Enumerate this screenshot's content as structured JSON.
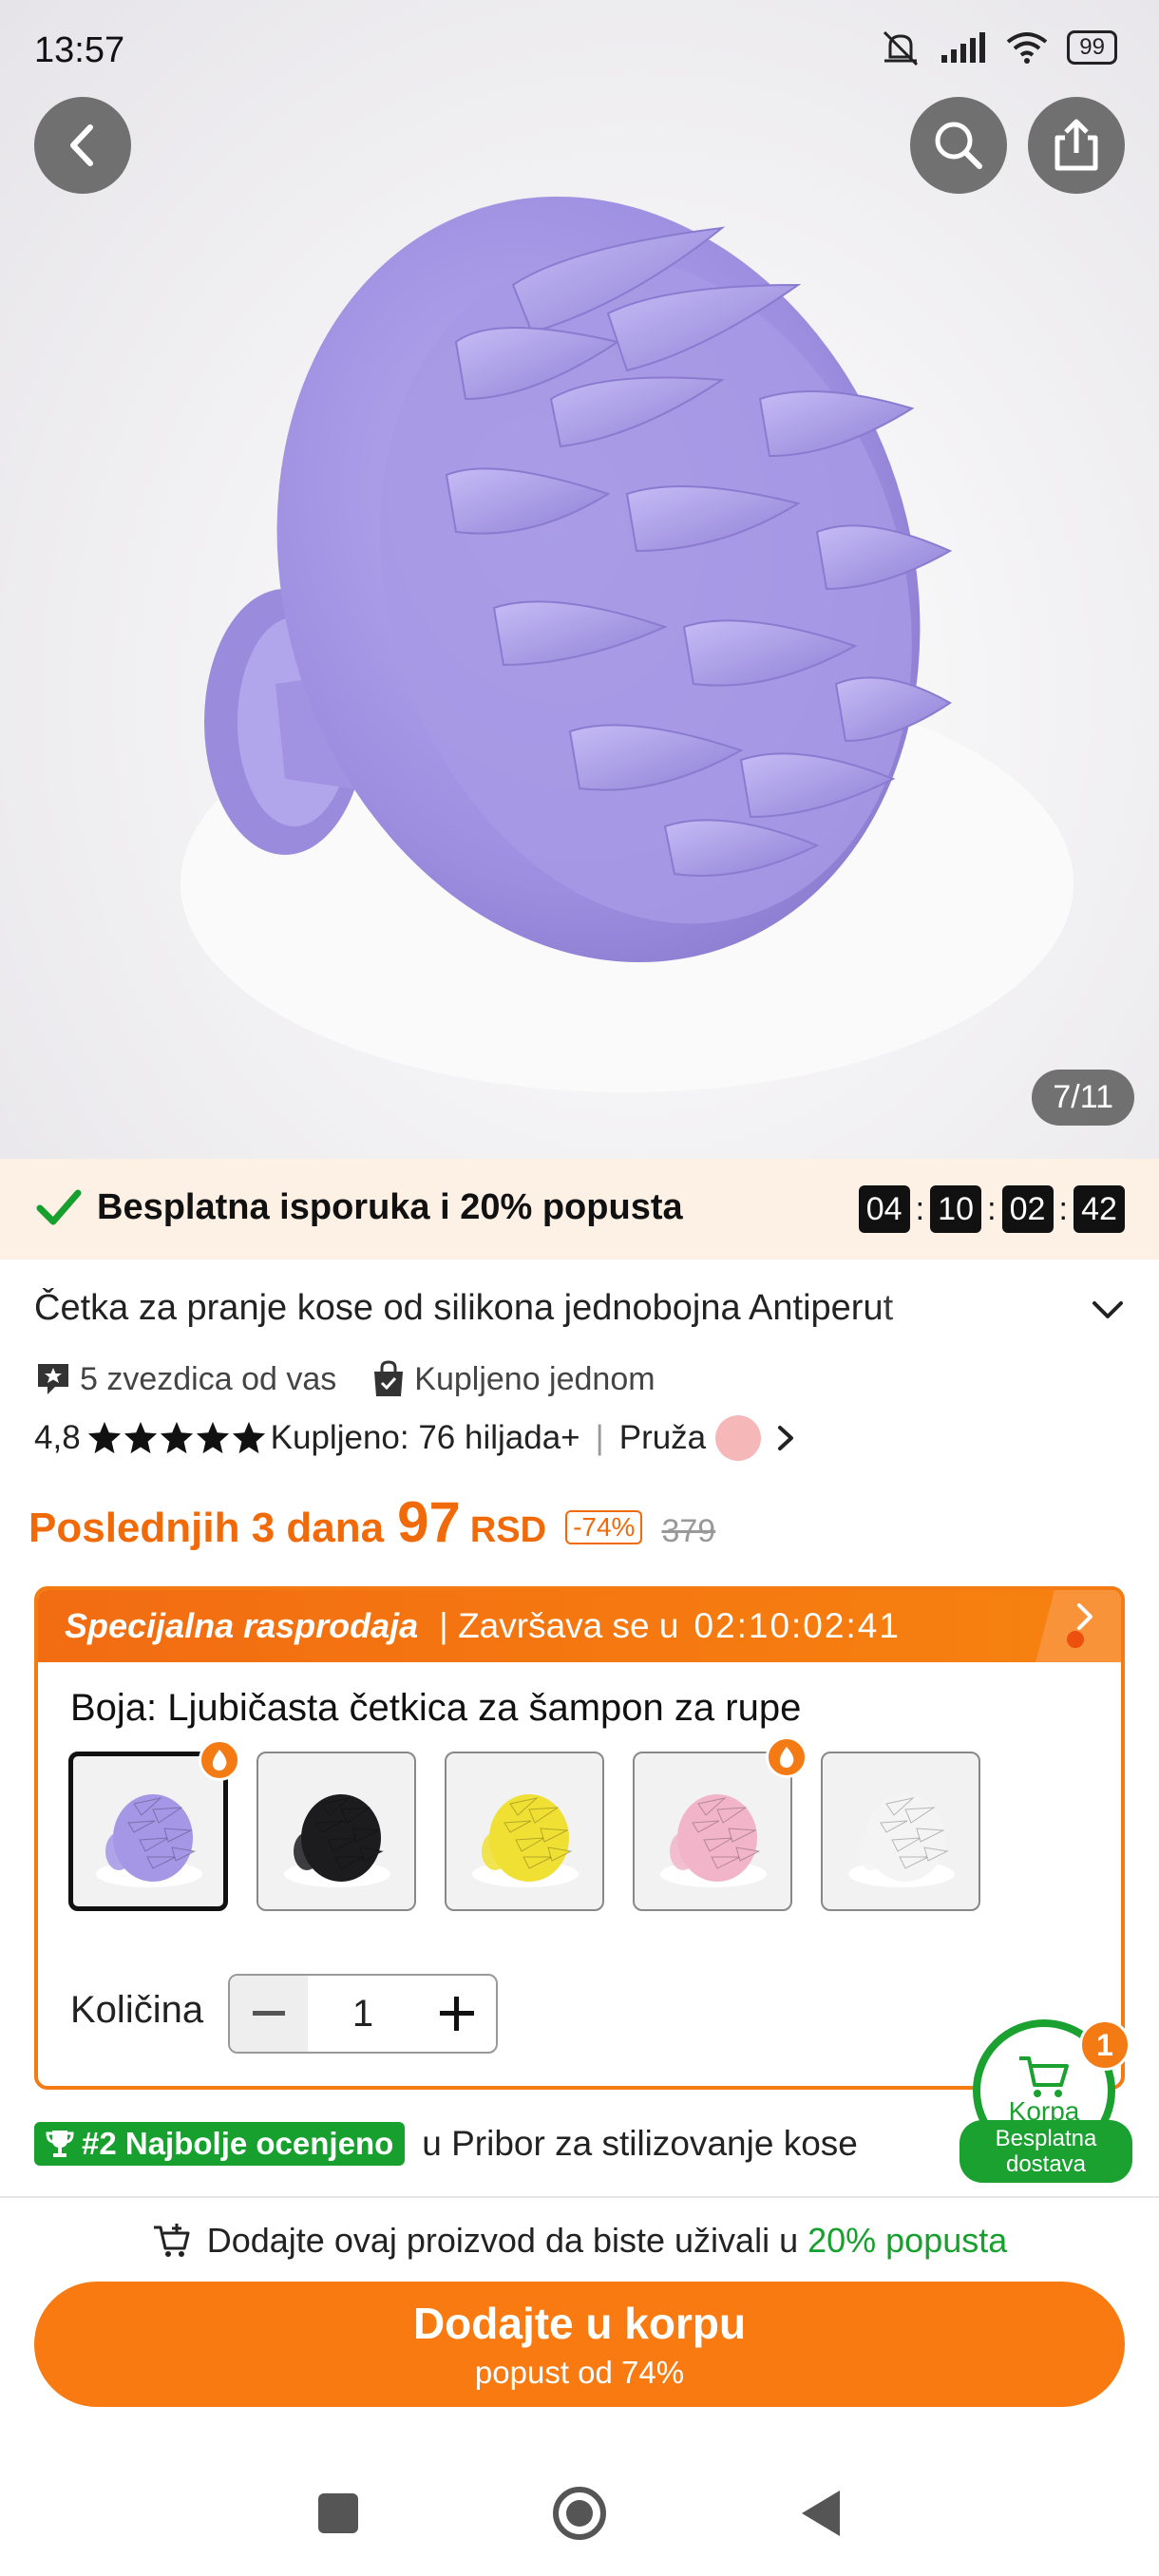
{
  "status_bar": {
    "time": "13:57",
    "battery": "99"
  },
  "gallery": {
    "counter": "7/11"
  },
  "promo": {
    "text": "Besplatna isporuka i 20% popusta",
    "timer": [
      "04",
      "10",
      "02",
      "42"
    ]
  },
  "product": {
    "title": "Četka za pranje kose od silikona jednobojna Antiperut",
    "rating_you": "5 zvezdica od vas",
    "bought_once": "Kupljeno jednom",
    "rating": "4,8",
    "stars": 5,
    "purchased": "Kupljeno: 76 hiljada+",
    "provider_label": "Pruža"
  },
  "price": {
    "label": "Poslednjih 3 dana",
    "value": "97",
    "currency": "RSD",
    "discount": "-74%",
    "old_price": "379"
  },
  "sale": {
    "title": "Specijalna rasprodaja",
    "ends_label": "| Završava se u",
    "ends_time": "02:10:02:41",
    "color_label": "Boja: Ljubičasta četkica za šampon za rupe",
    "swatches": [
      {
        "color": "#a596e6",
        "selected": true,
        "hot": true
      },
      {
        "color": "#1c1c1e",
        "selected": false,
        "hot": false
      },
      {
        "color": "#f0e033",
        "selected": false,
        "hot": false
      },
      {
        "color": "#f2b4c8",
        "selected": false,
        "hot": true
      },
      {
        "color": "#f4f4f4",
        "selected": false,
        "hot": false
      }
    ],
    "qty_label": "Količina",
    "qty_value": "1"
  },
  "cart": {
    "label": "Korpa",
    "badge": "1",
    "free_line1": "Besplatna",
    "free_line2": "dostava"
  },
  "rank": {
    "badge": "#2 Najbolje ocenjeno",
    "text": "u Pribor za stilizovanje kose"
  },
  "add_hint": {
    "prefix": "Dodajte ovaj proizvod da biste uživali u",
    "highlight": "20% popusta"
  },
  "add_button": {
    "label": "Dodajte u korpu",
    "sub": "popust od 74%"
  },
  "colors": {
    "accent": "#f87a10",
    "green": "#17a02e",
    "brush": "#a596e6"
  }
}
